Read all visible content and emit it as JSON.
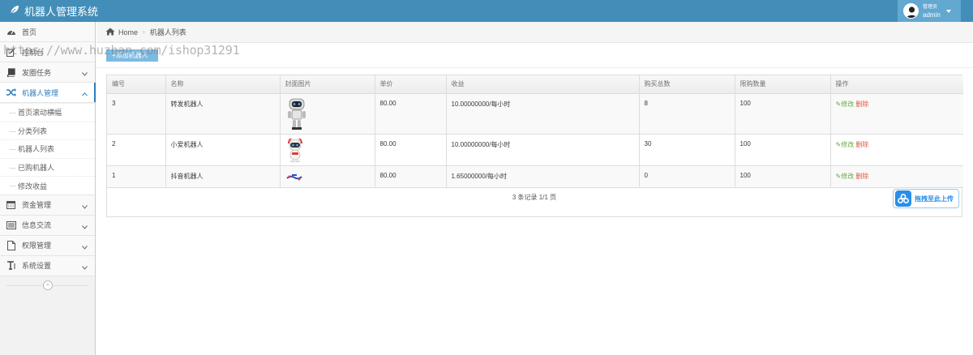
{
  "app": {
    "title": "机器人管理系统"
  },
  "user": {
    "role": "管理员",
    "name": "admin"
  },
  "sidebar": {
    "items": [
      {
        "label": "首页"
      },
      {
        "label": "控制台"
      },
      {
        "label": "发圈任务"
      },
      {
        "label": "机器人管理"
      },
      {
        "label": "资金管理"
      },
      {
        "label": "信息交流"
      },
      {
        "label": "权限管理"
      },
      {
        "label": "系统设置"
      }
    ],
    "submenu": [
      "首页滚动横幅",
      "分类列表",
      "机器人列表",
      "已购机器人",
      "修改收益"
    ],
    "collapse_glyph": "«"
  },
  "breadcrumb": {
    "home": "Home",
    "current": "机器人列表"
  },
  "watermark": "https://www.huzhan.com/ishop31291",
  "toolbar": {
    "add_label": "+添加机器人"
  },
  "table": {
    "headers": [
      "编号",
      "名称",
      "封面图片",
      "单价",
      "收益",
      "购买总数",
      "限购数量",
      "操作"
    ],
    "rows": [
      {
        "id": "3",
        "name": "转发机器人",
        "price": "80.00",
        "income": "10.00000000/每小时",
        "total": "8",
        "limit": "100"
      },
      {
        "id": "2",
        "name": "小爱机器人",
        "price": "80.00",
        "income": "10.00000000/每小时",
        "total": "30",
        "limit": "100"
      },
      {
        "id": "1",
        "name": "抖音机器人",
        "price": "80.00",
        "income": "1.65000000/每小时",
        "total": "0",
        "limit": "100"
      }
    ],
    "edit_label": "修改",
    "delete_label": "删除",
    "pager": "3 条记录 1/1 页"
  },
  "upload": {
    "label": "拖拽至此上传"
  },
  "colors": {
    "navbar": "#438eb9",
    "accent": "#2b7dbc",
    "edit": "#69aa46",
    "delete": "#dd5a43",
    "upload": "#2a8ee8"
  }
}
